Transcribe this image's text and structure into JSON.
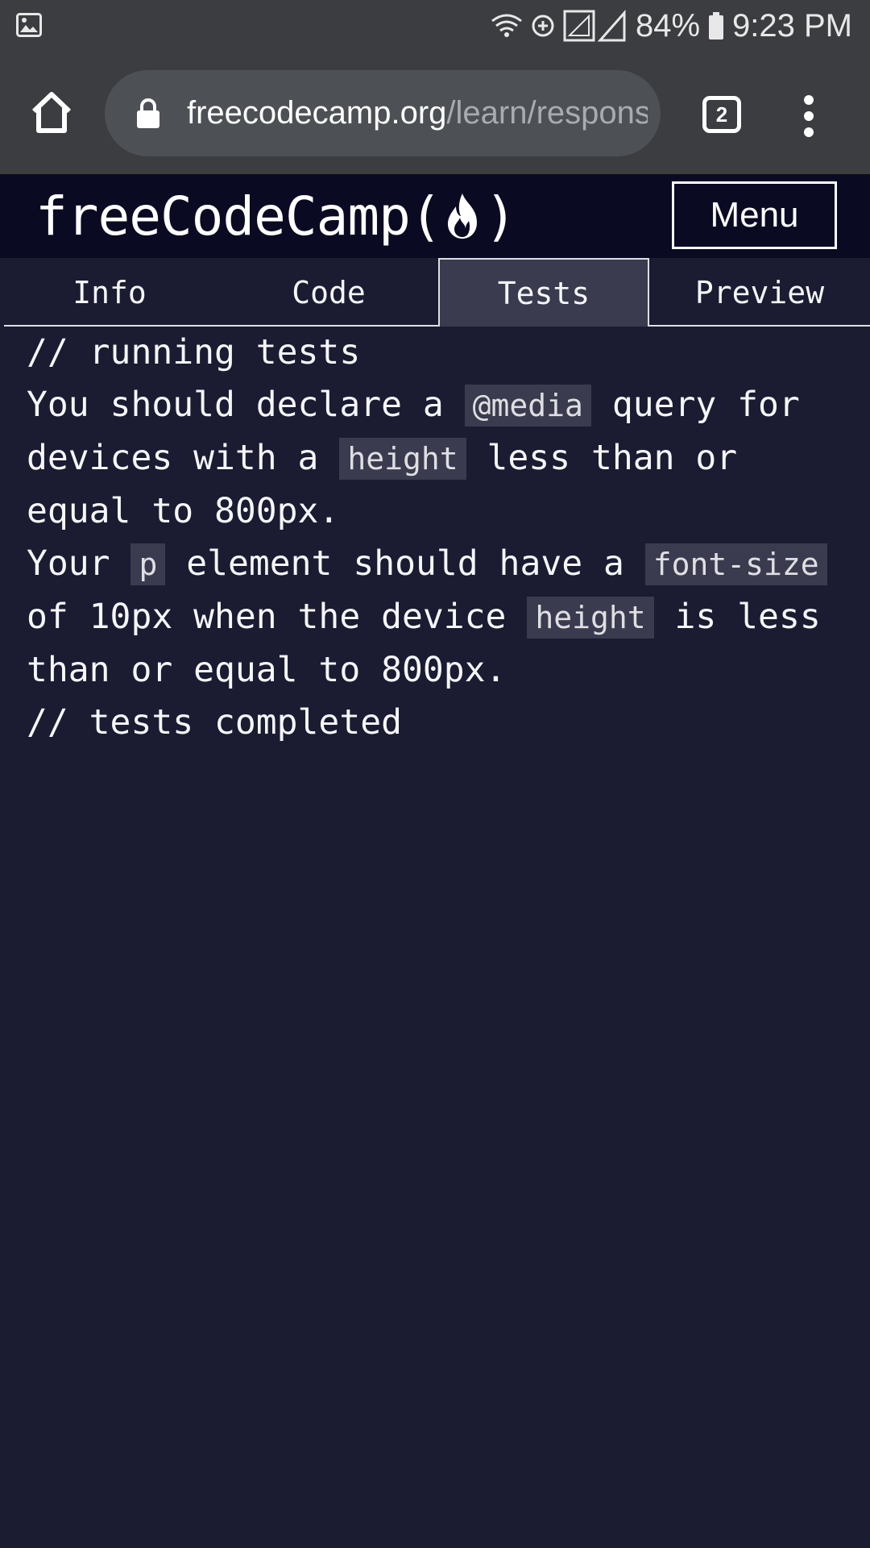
{
  "status_bar": {
    "battery": "84%",
    "time": "9:23 PM"
  },
  "browser": {
    "url_host": "freecodecamp.org",
    "url_path": "/learn/respons",
    "tab_count": "2"
  },
  "header": {
    "logo_left": "freeCodeCamp(",
    "logo_right": ")",
    "menu_label": "Menu"
  },
  "tabs": [
    {
      "label": "Info",
      "active": false
    },
    {
      "label": "Code",
      "active": false
    },
    {
      "label": "Tests",
      "active": true
    },
    {
      "label": "Preview",
      "active": false
    }
  ],
  "output": {
    "start": "// running tests",
    "test1": {
      "p1": "You should declare a ",
      "c1": "@media",
      "p2": " query for devices with a ",
      "c2": "height",
      "p3": " less than or equal to 800px."
    },
    "test2": {
      "p1": "Your ",
      "c1": "p",
      "p2": " element should have a ",
      "c2": "font-size",
      "p3": " of 10px when the device ",
      "c3": "height",
      "p4": " is less than or equal to 800px."
    },
    "end": "// tests completed"
  },
  "colors": {
    "page_bg": "#1b1b32",
    "header_bg": "#0a0a23",
    "active_tab_bg": "#3b3b4f",
    "chrome_bg": "#3b3d40"
  },
  "icons": [
    "image-icon",
    "wifi-icon",
    "data-saver-icon",
    "signal-icon",
    "battery-icon",
    "home-icon",
    "lock-icon",
    "more-vert-icon",
    "flame-icon"
  ]
}
